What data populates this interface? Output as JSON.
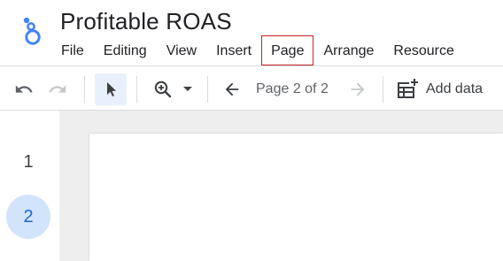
{
  "app": {
    "logo_icon": "looker-studio-logo",
    "report_title": "Profitable ROAS"
  },
  "menu": {
    "items": [
      {
        "id": "file",
        "label": "File"
      },
      {
        "id": "editing",
        "label": "Editing"
      },
      {
        "id": "view",
        "label": "View"
      },
      {
        "id": "insert",
        "label": "Insert"
      },
      {
        "id": "page",
        "label": "Page"
      },
      {
        "id": "arrange",
        "label": "Arrange"
      },
      {
        "id": "resource",
        "label": "Resource"
      }
    ]
  },
  "toolbar": {
    "undo_icon": "undo-icon",
    "redo_icon": "redo-icon",
    "select_icon": "pointer-icon",
    "zoom_icon": "zoom-icon",
    "prev_page_icon": "arrow-left-icon",
    "page_indicator": "Page 2 of 2",
    "next_page_icon": "arrow-right-icon",
    "add_data_icon": "add-data-icon",
    "add_data_label": "Add data"
  },
  "pages_panel": {
    "pages": [
      "1",
      "2"
    ],
    "active": "2"
  },
  "colors": {
    "accent": "#1a73e8",
    "highlight_border": "#c5221f",
    "active_page_bg": "#d2e3fc",
    "canvas_bg": "#eeeeee"
  }
}
